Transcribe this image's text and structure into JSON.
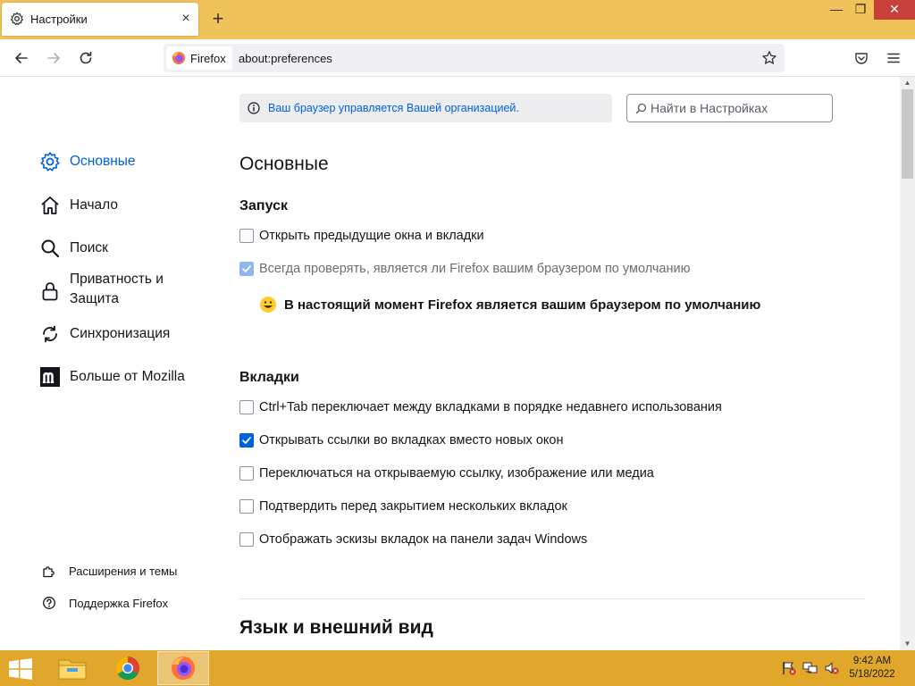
{
  "window": {
    "tab_title": "Настройки",
    "tab_close": "×",
    "new_tab": "+",
    "minimize": "—",
    "maximize": "❐",
    "close": "✕"
  },
  "navbar": {
    "identity_label": "Firefox",
    "url": "about:preferences"
  },
  "policy": {
    "message": "Ваш браузер управляется Вашей организацией."
  },
  "search": {
    "placeholder": "Найти в Настройках"
  },
  "sidebar": {
    "categories": [
      {
        "label": "Основные",
        "icon": "gear-icon",
        "active": true
      },
      {
        "label": "Начало",
        "icon": "home-icon"
      },
      {
        "label": "Поиск",
        "icon": "search-icon"
      },
      {
        "label": "Приватность и Защита",
        "icon": "lock-icon"
      },
      {
        "label": "Синхронизация",
        "icon": "sync-icon"
      },
      {
        "label": "Больше от Mozilla",
        "icon": "mozilla-icon"
      }
    ],
    "footer": [
      {
        "label": "Расширения и темы",
        "icon": "puzzle-icon"
      },
      {
        "label": "Поддержка Firefox",
        "icon": "help-icon"
      }
    ]
  },
  "main": {
    "page_title": "Основные",
    "startup": {
      "title": "Запуск",
      "options": [
        {
          "label": "Открыть предыдущие окна и вкладки",
          "checked": false,
          "disabled": false
        },
        {
          "label": "Всегда проверять, является ли Firefox вашим браузером по умолчанию",
          "checked": true,
          "disabled": true
        }
      ],
      "default_status": "В настоящий момент Firefox является вашим браузером по умолчанию"
    },
    "tabs": {
      "title": "Вкладки",
      "options": [
        {
          "label": "Ctrl+Tab переключает между вкладками в порядке недавнего использования",
          "checked": false
        },
        {
          "label": "Открывать ссылки во вкладках вместо новых окон",
          "checked": true
        },
        {
          "label": "Переключаться на открываемую ссылку, изображение или медиа",
          "checked": false
        },
        {
          "label": "Подтвердить перед закрытием нескольких вкладок",
          "checked": false
        },
        {
          "label": "Отображать эскизы вкладок на панели задач Windows",
          "checked": false
        }
      ]
    },
    "language_title": "Язык и внешний вид"
  },
  "taskbar": {
    "time": "9:42 AM",
    "date": "5/18/2022"
  },
  "colors": {
    "accent": "#0061e0",
    "tabstrip": "#f0c35a",
    "taskbar": "#e0a72a"
  }
}
